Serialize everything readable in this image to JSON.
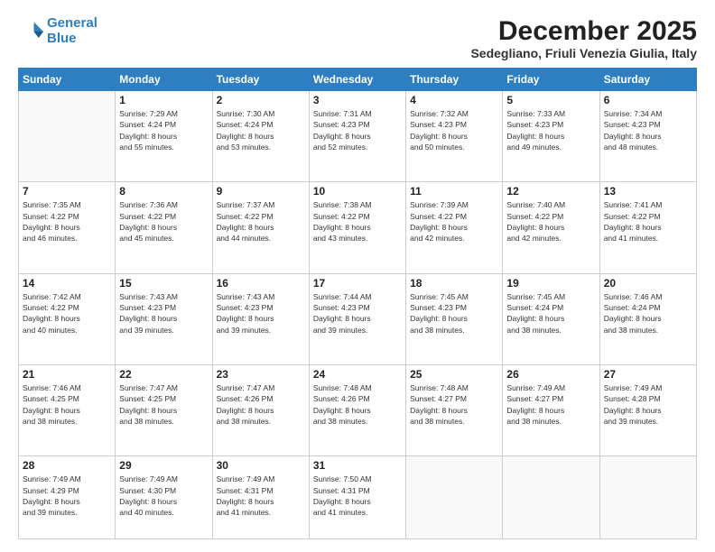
{
  "logo": {
    "line1": "General",
    "line2": "Blue"
  },
  "header": {
    "month": "December 2025",
    "location": "Sedegliano, Friuli Venezia Giulia, Italy"
  },
  "weekdays": [
    "Sunday",
    "Monday",
    "Tuesday",
    "Wednesday",
    "Thursday",
    "Friday",
    "Saturday"
  ],
  "weeks": [
    [
      {
        "day": "",
        "info": ""
      },
      {
        "day": "1",
        "info": "Sunrise: 7:29 AM\nSunset: 4:24 PM\nDaylight: 8 hours\nand 55 minutes."
      },
      {
        "day": "2",
        "info": "Sunrise: 7:30 AM\nSunset: 4:24 PM\nDaylight: 8 hours\nand 53 minutes."
      },
      {
        "day": "3",
        "info": "Sunrise: 7:31 AM\nSunset: 4:23 PM\nDaylight: 8 hours\nand 52 minutes."
      },
      {
        "day": "4",
        "info": "Sunrise: 7:32 AM\nSunset: 4:23 PM\nDaylight: 8 hours\nand 50 minutes."
      },
      {
        "day": "5",
        "info": "Sunrise: 7:33 AM\nSunset: 4:23 PM\nDaylight: 8 hours\nand 49 minutes."
      },
      {
        "day": "6",
        "info": "Sunrise: 7:34 AM\nSunset: 4:23 PM\nDaylight: 8 hours\nand 48 minutes."
      }
    ],
    [
      {
        "day": "7",
        "info": "Sunrise: 7:35 AM\nSunset: 4:22 PM\nDaylight: 8 hours\nand 46 minutes."
      },
      {
        "day": "8",
        "info": "Sunrise: 7:36 AM\nSunset: 4:22 PM\nDaylight: 8 hours\nand 45 minutes."
      },
      {
        "day": "9",
        "info": "Sunrise: 7:37 AM\nSunset: 4:22 PM\nDaylight: 8 hours\nand 44 minutes."
      },
      {
        "day": "10",
        "info": "Sunrise: 7:38 AM\nSunset: 4:22 PM\nDaylight: 8 hours\nand 43 minutes."
      },
      {
        "day": "11",
        "info": "Sunrise: 7:39 AM\nSunset: 4:22 PM\nDaylight: 8 hours\nand 42 minutes."
      },
      {
        "day": "12",
        "info": "Sunrise: 7:40 AM\nSunset: 4:22 PM\nDaylight: 8 hours\nand 42 minutes."
      },
      {
        "day": "13",
        "info": "Sunrise: 7:41 AM\nSunset: 4:22 PM\nDaylight: 8 hours\nand 41 minutes."
      }
    ],
    [
      {
        "day": "14",
        "info": "Sunrise: 7:42 AM\nSunset: 4:22 PM\nDaylight: 8 hours\nand 40 minutes."
      },
      {
        "day": "15",
        "info": "Sunrise: 7:43 AM\nSunset: 4:23 PM\nDaylight: 8 hours\nand 39 minutes."
      },
      {
        "day": "16",
        "info": "Sunrise: 7:43 AM\nSunset: 4:23 PM\nDaylight: 8 hours\nand 39 minutes."
      },
      {
        "day": "17",
        "info": "Sunrise: 7:44 AM\nSunset: 4:23 PM\nDaylight: 8 hours\nand 39 minutes."
      },
      {
        "day": "18",
        "info": "Sunrise: 7:45 AM\nSunset: 4:23 PM\nDaylight: 8 hours\nand 38 minutes."
      },
      {
        "day": "19",
        "info": "Sunrise: 7:45 AM\nSunset: 4:24 PM\nDaylight: 8 hours\nand 38 minutes."
      },
      {
        "day": "20",
        "info": "Sunrise: 7:46 AM\nSunset: 4:24 PM\nDaylight: 8 hours\nand 38 minutes."
      }
    ],
    [
      {
        "day": "21",
        "info": "Sunrise: 7:46 AM\nSunset: 4:25 PM\nDaylight: 8 hours\nand 38 minutes."
      },
      {
        "day": "22",
        "info": "Sunrise: 7:47 AM\nSunset: 4:25 PM\nDaylight: 8 hours\nand 38 minutes."
      },
      {
        "day": "23",
        "info": "Sunrise: 7:47 AM\nSunset: 4:26 PM\nDaylight: 8 hours\nand 38 minutes."
      },
      {
        "day": "24",
        "info": "Sunrise: 7:48 AM\nSunset: 4:26 PM\nDaylight: 8 hours\nand 38 minutes."
      },
      {
        "day": "25",
        "info": "Sunrise: 7:48 AM\nSunset: 4:27 PM\nDaylight: 8 hours\nand 38 minutes."
      },
      {
        "day": "26",
        "info": "Sunrise: 7:49 AM\nSunset: 4:27 PM\nDaylight: 8 hours\nand 38 minutes."
      },
      {
        "day": "27",
        "info": "Sunrise: 7:49 AM\nSunset: 4:28 PM\nDaylight: 8 hours\nand 39 minutes."
      }
    ],
    [
      {
        "day": "28",
        "info": "Sunrise: 7:49 AM\nSunset: 4:29 PM\nDaylight: 8 hours\nand 39 minutes."
      },
      {
        "day": "29",
        "info": "Sunrise: 7:49 AM\nSunset: 4:30 PM\nDaylight: 8 hours\nand 40 minutes."
      },
      {
        "day": "30",
        "info": "Sunrise: 7:49 AM\nSunset: 4:31 PM\nDaylight: 8 hours\nand 41 minutes."
      },
      {
        "day": "31",
        "info": "Sunrise: 7:50 AM\nSunset: 4:31 PM\nDaylight: 8 hours\nand 41 minutes."
      },
      {
        "day": "",
        "info": ""
      },
      {
        "day": "",
        "info": ""
      },
      {
        "day": "",
        "info": ""
      }
    ]
  ]
}
